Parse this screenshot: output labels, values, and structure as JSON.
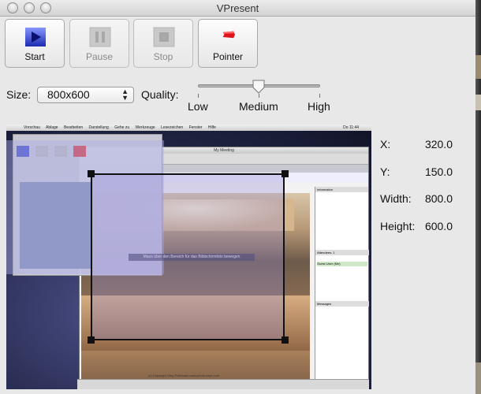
{
  "window": {
    "title": "VPresent"
  },
  "toolbar": {
    "start_label": "Start",
    "pause_label": "Pause",
    "stop_label": "Stop",
    "pointer_label": "Pointer"
  },
  "controls": {
    "size_label": "Size:",
    "size_value": "800x600",
    "quality_label": "Quality:",
    "quality_level": "Medium",
    "quality_options": [
      "Low",
      "Medium",
      "High"
    ]
  },
  "capture": {
    "x_label": "X:",
    "x_value": "320.0",
    "y_label": "Y:",
    "y_value": "150.0",
    "width_label": "Width:",
    "width_value": "800.0",
    "height_label": "Height:",
    "height_value": "600.0"
  },
  "preview": {
    "menubar": [
      "Vorschau",
      "Ablage",
      "Bearbeiten",
      "Darstellung",
      "Gehe zu",
      "Werkzeuge",
      "Lesezeichen",
      "Fenster",
      "Hilfe"
    ],
    "clock": "Do 11:44",
    "meeting_title": "My Meeting",
    "hint": "Maus über den Bereich für das Bildschirmfoto bewegen",
    "copyright": "(c) Copyright Oleg Prikhodko www.photo.oxyz.com",
    "panel_information": "Information",
    "panel_attendees": "Attendees: 1",
    "panel_messages": "Messages",
    "attendee": "Guest User (Me)"
  },
  "colors": {
    "accent_blue": "#2c3dbb",
    "pointer_red": "#e0141b",
    "overlay": "#a09ad8"
  }
}
